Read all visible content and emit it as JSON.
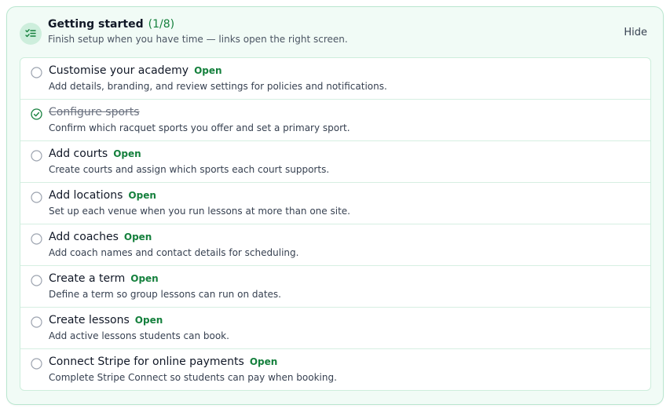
{
  "header": {
    "icon": "checklist-icon",
    "title": "Getting started",
    "progress": "(1/8)",
    "subtitle": "Finish setup when you have time — links open the right screen.",
    "hide_label": "Hide"
  },
  "items": [
    {
      "title": "Customise your academy",
      "description": "Add details, branding, and review settings for policies and notifications.",
      "done": false,
      "link": "Open"
    },
    {
      "title": "Configure sports",
      "description": "Confirm which racquet sports you offer and set a primary sport.",
      "done": true,
      "link": ""
    },
    {
      "title": "Add courts",
      "description": "Create courts and assign which sports each court supports.",
      "done": false,
      "link": "Open"
    },
    {
      "title": "Add locations",
      "description": "Set up each venue when you run lessons at more than one site.",
      "done": false,
      "link": "Open"
    },
    {
      "title": "Add coaches",
      "description": "Add coach names and contact details for scheduling.",
      "done": false,
      "link": "Open"
    },
    {
      "title": "Create a term",
      "description": "Define a term so group lessons can run on dates.",
      "done": false,
      "link": "Open"
    },
    {
      "title": "Create lessons",
      "description": "Add active lessons students can book.",
      "done": false,
      "link": "Open"
    },
    {
      "title": "Connect Stripe for online payments",
      "description": "Complete Stripe Connect so students can pay when booking.",
      "done": false,
      "link": "Open"
    }
  ],
  "colors": {
    "accent": "#15803d",
    "card_bg": "#f1fbf6",
    "card_border": "#b9e6cf"
  }
}
